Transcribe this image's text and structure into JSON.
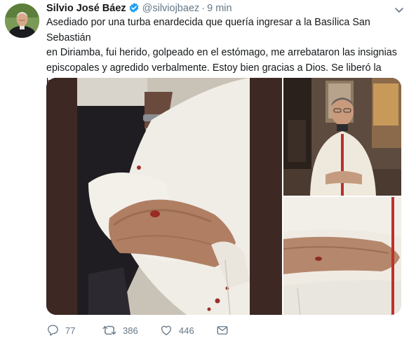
{
  "tweet": {
    "author_name": "Silvio José Báez",
    "handle": "@silviojbaez",
    "separator": "·",
    "time": "9 min",
    "text": "Asediado por una turba enardecida que quería ingresar a la Basílica San Sebastián\nen Diriamba, fui herido, golpeado en el estómago, me arrebataron las insignias\nepiscopales  y agredido verbalmente. Estoy bien gracias a Dios. Se liberó la\nbasílica y a quienes allí estaban.",
    "verified": true
  },
  "actions": {
    "replies": "77",
    "retweets": "386",
    "likes": "446"
  },
  "colors": {
    "accent": "#1da1f2",
    "muted": "#657786",
    "text": "#14171a"
  },
  "icons": [
    "verified-badge-icon",
    "chevron-down-icon",
    "reply-icon",
    "retweet-icon",
    "like-icon",
    "direct-message-icon"
  ]
}
